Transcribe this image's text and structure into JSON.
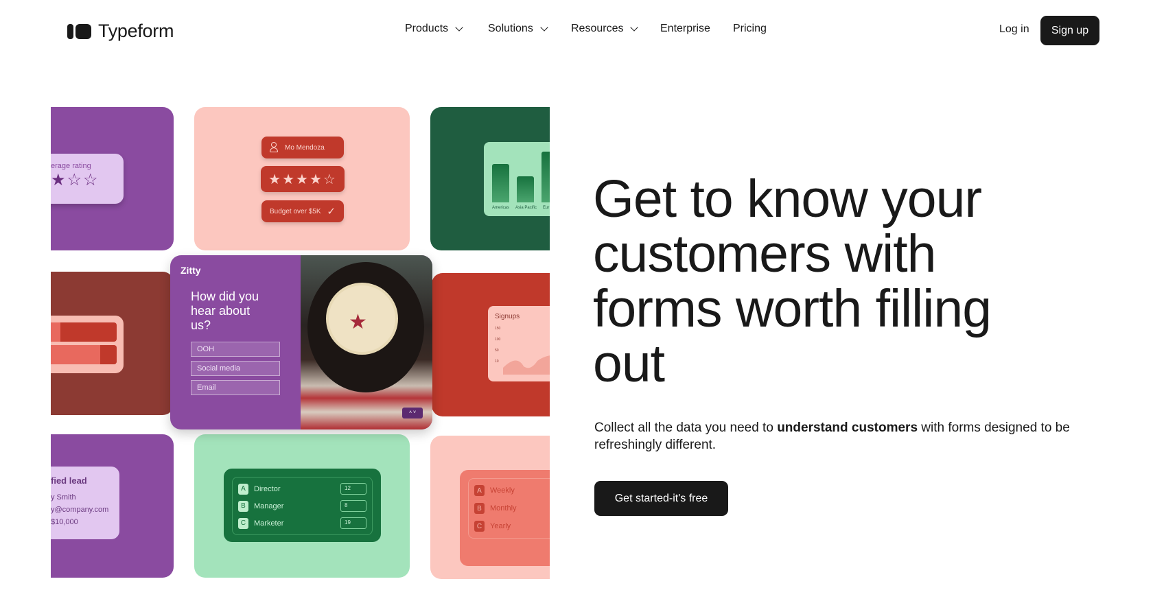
{
  "brand": {
    "name": "Typeform",
    "logo_icon": "typeform-logo-icon"
  },
  "nav": {
    "items": [
      {
        "label": "Products",
        "dropdown": true
      },
      {
        "label": "Solutions",
        "dropdown": true
      },
      {
        "label": "Resources",
        "dropdown": true
      },
      {
        "label": "Enterprise",
        "dropdown": false
      },
      {
        "label": "Pricing",
        "dropdown": false
      }
    ],
    "login": "Log in",
    "signup": "Sign up"
  },
  "hero": {
    "heading": "Get to know your customers with forms worth filling out",
    "body_pre": "Collect all the data you need to ",
    "body_bold": "understand customers",
    "body_post": " with forms designed to be refreshingly different.",
    "cta": "Get started-it's free"
  },
  "collage": {
    "rating_card": {
      "label": "erage rating",
      "stars_filled": 2,
      "stars_total": 3
    },
    "profile_card": {
      "name": "Mo Mendoza",
      "rating": "★★★★☆",
      "budget": "Budget over $5K"
    },
    "chart_card": {
      "labels": [
        "Americas",
        "Asia Pacific",
        "Eur"
      ]
    },
    "zitty": {
      "brand": "Zitty",
      "question": "How did you hear about us?",
      "options": [
        "OOH",
        "Social media",
        "Email"
      ]
    },
    "signups_card": {
      "title": "Signups",
      "ticks": [
        "150",
        "100",
        "50",
        "10"
      ]
    },
    "lead_card": {
      "title": "fied lead",
      "name": "y Smith",
      "email": "y@company.com",
      "budget": "$10,000"
    },
    "roles_card": {
      "rows": [
        {
          "key": "A",
          "label": "Director",
          "value": "12"
        },
        {
          "key": "B",
          "label": "Manager",
          "value": "8"
        },
        {
          "key": "C",
          "label": "Marketer",
          "value": "19"
        }
      ]
    },
    "frequency_card": {
      "rows": [
        {
          "key": "A",
          "label": "Weekly"
        },
        {
          "key": "B",
          "label": "Monthly"
        },
        {
          "key": "C",
          "label": "Yearly"
        }
      ]
    }
  },
  "colors": {
    "purple": "#8a4ba0",
    "pink": "#fcc7bf",
    "dark_green": "#1f5d40",
    "brown": "#8c3a33",
    "red": "#c0392b",
    "mint": "#a3e3bb",
    "black": "#191919"
  }
}
